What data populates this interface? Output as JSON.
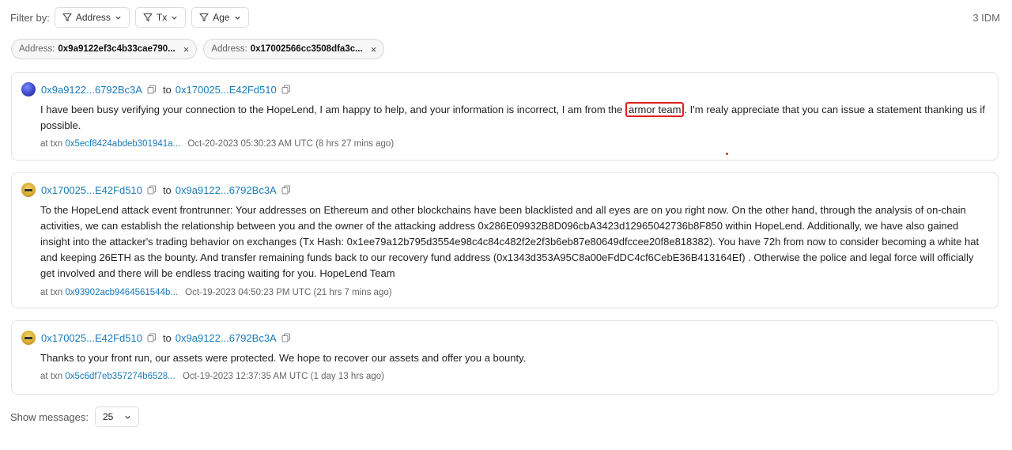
{
  "filter_bar": {
    "label": "Filter by:",
    "buttons": [
      {
        "label": "Address"
      },
      {
        "label": "Tx"
      },
      {
        "label": "Age"
      }
    ],
    "count": "3 IDM"
  },
  "chips": [
    {
      "key": "Address:",
      "value": "0x9a9122ef3c4b33cae790...",
      "close": "×"
    },
    {
      "key": "Address:",
      "value": "0x17002566cc3508dfa3c...",
      "close": "×"
    }
  ],
  "messages": [
    {
      "from": "0x9a9122...6792Bc3A",
      "to_word": "to",
      "to": "0x170025...E42Fd510",
      "text_before": "I have been busy verifying your connection to the HopeLend, I am happy to help, and your information is incorrect, I am from the",
      "text_highlight": "armor team",
      "text_after": ". I'm realy appreciate that you can issue a statement thanking us if possible.",
      "at_txn": "at txn",
      "txn": "0x5ecf8424abdeb301941a...",
      "time": "Oct-20-2023 05:30:23 AM UTC (8 hrs 27 mins ago)"
    },
    {
      "from": "0x170025...E42Fd510",
      "to_word": "to",
      "to": "0x9a9122...6792Bc3A",
      "text": "To the HopeLend attack event frontrunner: Your addresses on Ethereum and other blockchains have been blacklisted and all eyes are on you right now. On the other hand, through the analysis of on-chain activities, we can establish the relationship between you and the owner of the attacking address 0x286E09932B8D096cbA3423d12965042736b8F850 within HopeLend. Additionally, we have also gained insight into the attacker's trading behavior on exchanges (Tx Hash: 0x1ee79a12b795d3554e98c4c84c482f2e2f3b6eb87e80649dfccee20f8e818382). You have 72h from now to consider becoming a white hat and keeping 26ETH as the bounty. And transfer remaining funds back to our recovery fund address (0x1343d353A95C8a00eFdDC4cf6CebE36B413164Ef) . Otherwise the police and legal force will officially get involved and there will be endless tracing waiting for you. HopeLend Team",
      "at_txn": "at txn",
      "txn": "0x93902acb9464561544b...",
      "time": "Oct-19-2023 04:50:23 PM UTC (21 hrs 7 mins ago)"
    },
    {
      "from": "0x170025...E42Fd510",
      "to_word": "to",
      "to": "0x9a9122...6792Bc3A",
      "text": "Thanks to your front run, our assets were protected. We hope to recover our assets and offer you a bounty.",
      "at_txn": "at txn",
      "txn": "0x5c6df7eb357274b6528...",
      "time": "Oct-19-2023 12:37:35 AM UTC (1 day 13 hrs ago)"
    }
  ],
  "footer": {
    "label": "Show messages:",
    "page_size": "25"
  },
  "icons": {
    "filter": "funnel-icon",
    "dropdown": "chevron-down-icon",
    "copy": "copy-icon",
    "close": "close-icon"
  },
  "colors": {
    "link": "#1a7ab8",
    "highlight_border": "#e02020"
  }
}
